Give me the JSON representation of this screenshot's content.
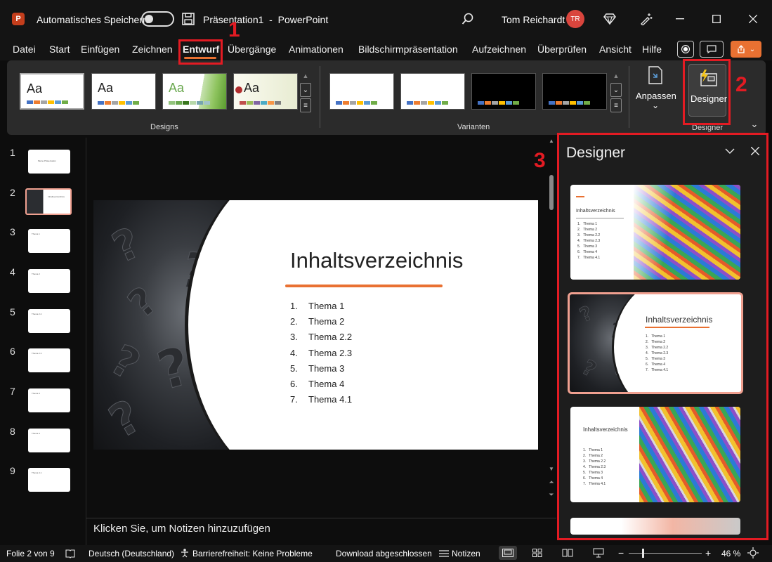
{
  "titlebar": {
    "autosave_label": "Automatisches Speichern",
    "doc_title": "Präsentation1  -  PowerPoint",
    "user_name": "Tom Reichardt",
    "user_initials": "TR"
  },
  "menu": {
    "items": [
      "Datei",
      "Start",
      "Einfügen",
      "Zeichnen",
      "Entwurf",
      "Übergänge",
      "Animationen",
      "Bildschirmpräsentation",
      "Aufzeichnen",
      "Überprüfen",
      "Ansicht",
      "Hilfe"
    ],
    "active": "Entwurf"
  },
  "ribbon": {
    "themes": [
      {
        "label": "Aa",
        "colors": [
          "#4472c4",
          "#ed7d31",
          "#a5a5a5",
          "#ffc000",
          "#5b9bd5",
          "#70ad47"
        ]
      },
      {
        "label": "Aa",
        "colors": [
          "#4472c4",
          "#ed7d31",
          "#a5a5a5",
          "#ffc000",
          "#5b9bd5",
          "#70ad47"
        ]
      },
      {
        "label": "Aa",
        "colors": [
          "#93c47d",
          "#6aa84f",
          "#38761d",
          "#b6d7a8",
          "#76a5af",
          "#a2c4c9"
        ]
      },
      {
        "label": "Aa",
        "colors": [
          "#c0504d",
          "#9bbb59",
          "#8064a2",
          "#4bacc6",
          "#f79646",
          "#7f7f7f"
        ]
      }
    ],
    "designs_group": "Designs",
    "variants_group": "Varianten",
    "variants": [
      {
        "bg": "#ffffff",
        "colors": [
          "#4472c4",
          "#ed7d31",
          "#a5a5a5",
          "#ffc000",
          "#5b9bd5",
          "#70ad47"
        ]
      },
      {
        "bg": "#ffffff",
        "colors": [
          "#4472c4",
          "#ed7d31",
          "#a5a5a5",
          "#ffc000",
          "#5b9bd5",
          "#70ad47"
        ]
      },
      {
        "bg": "#000000",
        "colors": [
          "#4472c4",
          "#ed7d31",
          "#a5a5a5",
          "#ffc000",
          "#5b9bd5",
          "#70ad47"
        ]
      },
      {
        "bg": "#000000",
        "colors": [
          "#4472c4",
          "#ed7d31",
          "#a5a5a5",
          "#ffc000",
          "#5b9bd5",
          "#70ad47"
        ]
      }
    ],
    "anpassen_label": "Anpassen",
    "designer_button_label": "Designer",
    "designer_group": "Designer"
  },
  "slides": [
    {
      "num": "1",
      "text": "Meine Präsentation"
    },
    {
      "num": "2",
      "text": "Inhaltsverzeichnis"
    },
    {
      "num": "3",
      "text": "Thema 1"
    },
    {
      "num": "4",
      "text": "Thema 2"
    },
    {
      "num": "5",
      "text": "Thema 2.2"
    },
    {
      "num": "6",
      "text": "Thema 2.3"
    },
    {
      "num": "7",
      "text": "Thema 3"
    },
    {
      "num": "8",
      "text": "Thema 4"
    },
    {
      "num": "9",
      "text": "Thema 4.1"
    }
  ],
  "slide": {
    "title": "Inhaltsverzeichnis",
    "items": [
      {
        "n": "1.",
        "t": "Thema 1"
      },
      {
        "n": "2.",
        "t": "Thema 2"
      },
      {
        "n": "3.",
        "t": "Thema 2.2"
      },
      {
        "n": "4.",
        "t": "Thema 2.3"
      },
      {
        "n": "5.",
        "t": "Thema 3"
      },
      {
        "n": "6.",
        "t": "Thema 4"
      },
      {
        "n": "7.",
        "t": "Thema 4.1"
      }
    ]
  },
  "notes_placeholder": "Klicken Sie, um Notizen hinzuzufügen",
  "designer_pane": {
    "title": "Designer",
    "card_title": "Inhaltsverzeichnis",
    "card_items": [
      "1.   Thema 1",
      "2.   Thema 2",
      "3.   Thema 2.2",
      "4.   Thema 2.3",
      "5.   Thema 3",
      "6.   Thema 4",
      "7.   Thema 4.1"
    ]
  },
  "annotations": {
    "one": "1",
    "two": "2",
    "three": "3"
  },
  "status": {
    "slide_of": "Folie 2 von 9",
    "language": "Deutsch (Deutschland)",
    "accessibility": "Barrierefreiheit: Keine Probleme",
    "download": "Download abgeschlossen",
    "notes": "Notizen",
    "zoom": "46 %"
  },
  "colors": {
    "accent_orange": "#e97132",
    "annotation_red": "#e31b23",
    "avatar_red": "#d9453d"
  }
}
